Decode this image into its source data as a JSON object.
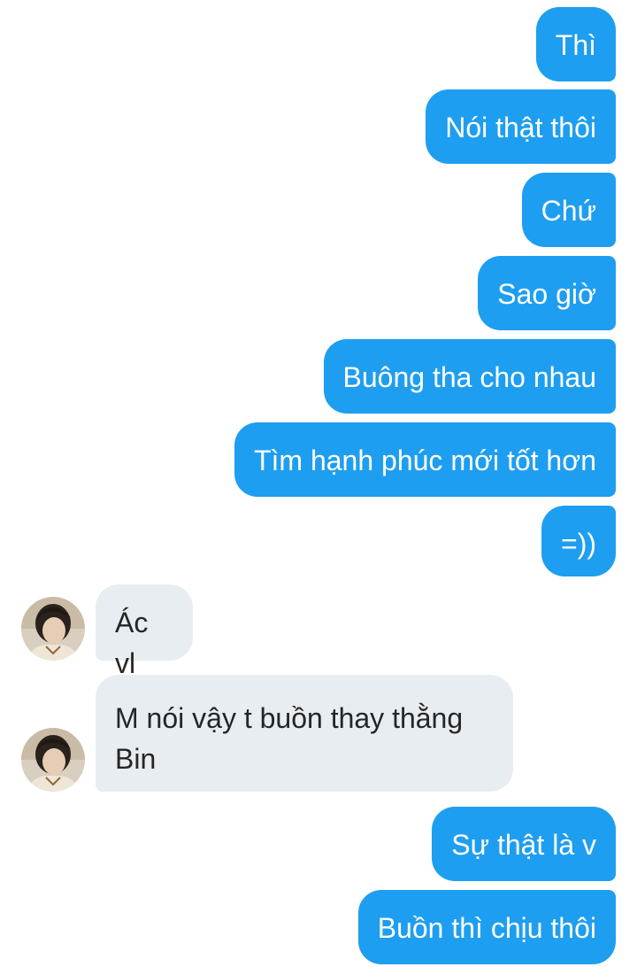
{
  "messages": [
    {
      "text": "Thì"
    },
    {
      "text": "Nói thật thôi"
    },
    {
      "text": "Chứ"
    },
    {
      "text": "Sao giờ"
    },
    {
      "text": "Buông tha cho nhau"
    },
    {
      "text": "Tìm hạnh phúc mới tốt hơn"
    },
    {
      "text": "=))"
    },
    {
      "text": "Ác vl"
    },
    {
      "text": "M nói vậy t buồn thay thằng Bin"
    },
    {
      "text": "Sự thật là v"
    },
    {
      "text": "Buồn thì chịu thôi"
    }
  ],
  "colors": {
    "outgoing_bubble": "#1e9ef0",
    "incoming_bubble": "#e8edf1",
    "outgoing_text": "#ffffff",
    "incoming_text": "#262626"
  }
}
